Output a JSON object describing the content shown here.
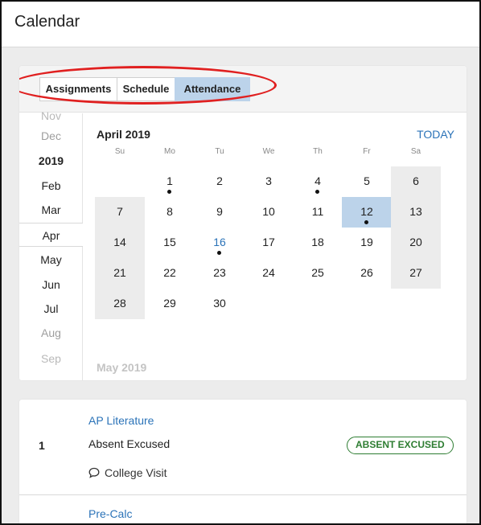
{
  "header": {
    "title": "Calendar"
  },
  "tabs": [
    {
      "label": "Assignments",
      "active": false
    },
    {
      "label": "Schedule",
      "active": false
    },
    {
      "label": "Attendance",
      "active": true
    }
  ],
  "month_rail": {
    "items": [
      {
        "label": "Nov",
        "style": "dim"
      },
      {
        "label": "Dec",
        "style": "muted"
      },
      {
        "label": "2019",
        "style": "year"
      },
      {
        "label": "Feb",
        "style": "normal"
      },
      {
        "label": "Mar",
        "style": "normal"
      },
      {
        "label": "Apr",
        "style": "selected"
      },
      {
        "label": "May",
        "style": "normal"
      },
      {
        "label": "Jun",
        "style": "normal"
      },
      {
        "label": "Jul",
        "style": "normal"
      },
      {
        "label": "Aug",
        "style": "muted"
      },
      {
        "label": "Sep",
        "style": "dim"
      }
    ]
  },
  "calendar": {
    "month_title": "April 2019",
    "today_label": "TODAY",
    "weekdays": [
      "Su",
      "Mo",
      "Tu",
      "We",
      "Th",
      "Fr",
      "Sa"
    ],
    "weeks": [
      [
        null,
        "1",
        "2",
        "3",
        "4",
        "5",
        "6"
      ],
      [
        "7",
        "8",
        "9",
        "10",
        "11",
        "12",
        "13"
      ],
      [
        "14",
        "15",
        "16",
        "17",
        "18",
        "19",
        "20"
      ],
      [
        "21",
        "22",
        "23",
        "24",
        "25",
        "26",
        "27"
      ],
      [
        "28",
        "29",
        "30",
        null,
        null,
        null,
        null
      ]
    ],
    "event_days": [
      "1",
      "4",
      "12",
      "16"
    ],
    "selected_day": "12",
    "today_day": "16",
    "next_month_title": "May 2019"
  },
  "attendance": {
    "entries": [
      {
        "period": "1",
        "course": "AP Literature",
        "status": "Absent Excused",
        "badge": "ABSENT EXCUSED",
        "comment": "College Visit"
      },
      {
        "course": "Pre-Calc"
      }
    ]
  },
  "colors": {
    "accent": "#2b73b8",
    "active_tab": "#bcd3ea",
    "badge_green": "#2e7d32",
    "annotation_red": "#e02020"
  }
}
